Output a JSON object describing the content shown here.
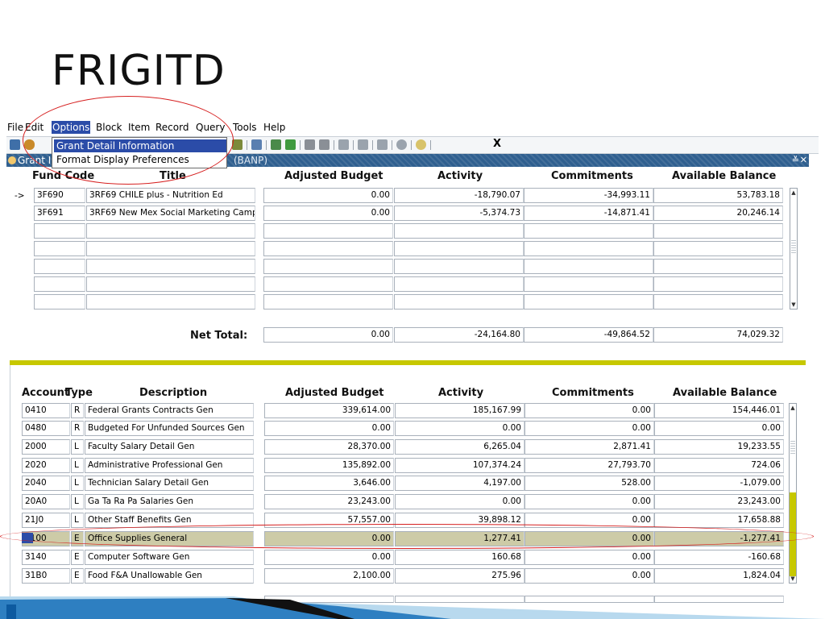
{
  "slide": {
    "title": "FRIGITD"
  },
  "menu": {
    "items": [
      {
        "label": "File"
      },
      {
        "label": "Edit"
      },
      {
        "label": "Options"
      },
      {
        "label": "Block"
      },
      {
        "label": "Item"
      },
      {
        "label": "Record"
      },
      {
        "label": "Query"
      },
      {
        "label": "Tools"
      },
      {
        "label": "Help"
      }
    ]
  },
  "toolbar": {
    "exit_label": "X"
  },
  "dropdown": {
    "item1": "Grant Detail Information [FRIGTRD]",
    "item2": "Format Display Preferences"
  },
  "window": {
    "title": "Grant I",
    "suffix": "(BANP)"
  },
  "fund_section": {
    "headers": {
      "fund_code": "Fund Code",
      "title": "Title",
      "adjusted_budget": "Adjusted Budget",
      "activity": "Activity",
      "commitments": "Commitments",
      "available_balance": "Available Balance"
    },
    "current_marker": "->",
    "rows": [
      {
        "fund_code": "3F690",
        "title": "3RF69 CHILE plus - Nutrition Ed",
        "adjusted_budget": "0.00",
        "activity": "-18,790.07",
        "commitments": "-34,993.11",
        "available_balance": "53,783.18"
      },
      {
        "fund_code": "3F691",
        "title": "3RF69 New Mex Social Marketing Camp",
        "adjusted_budget": "0.00",
        "activity": "-5,374.73",
        "commitments": "-14,871.41",
        "available_balance": "20,246.14"
      }
    ],
    "net_total_label": "Net Total:",
    "net_total": {
      "adjusted_budget": "0.00",
      "activity": "-24,164.80",
      "commitments": "-49,864.52",
      "available_balance": "74,029.32"
    }
  },
  "account_section": {
    "headers": {
      "account": "Account",
      "type": "Type",
      "description": "Description",
      "adjusted_budget": "Adjusted Budget",
      "activity": "Activity",
      "commitments": "Commitments",
      "available_balance": "Available Balance"
    },
    "rows": [
      {
        "account": "0410",
        "type": "R",
        "description": "Federal Grants Contracts Gen",
        "adjusted_budget": "339,614.00",
        "activity": "185,167.99",
        "commitments": "0.00",
        "available_balance": "154,446.01"
      },
      {
        "account": "0480",
        "type": "R",
        "description": "Budgeted For Unfunded Sources Gen",
        "adjusted_budget": "0.00",
        "activity": "0.00",
        "commitments": "0.00",
        "available_balance": "0.00"
      },
      {
        "account": "2000",
        "type": "L",
        "description": "Faculty Salary Detail Gen",
        "adjusted_budget": "28,370.00",
        "activity": "6,265.04",
        "commitments": "2,871.41",
        "available_balance": "19,233.55"
      },
      {
        "account": "2020",
        "type": "L",
        "description": "Administrative Professional Gen",
        "adjusted_budget": "135,892.00",
        "activity": "107,374.24",
        "commitments": "27,793.70",
        "available_balance": "724.06"
      },
      {
        "account": "2040",
        "type": "L",
        "description": "Technician Salary Detail Gen",
        "adjusted_budget": "3,646.00",
        "activity": "4,197.00",
        "commitments": "528.00",
        "available_balance": "-1,079.00"
      },
      {
        "account": "20A0",
        "type": "L",
        "description": "Ga Ta Ra Pa Salaries Gen",
        "adjusted_budget": "23,243.00",
        "activity": "0.00",
        "commitments": "0.00",
        "available_balance": "23,243.00"
      },
      {
        "account": "21J0",
        "type": "L",
        "description": "Other Staff Benefits Gen",
        "adjusted_budget": "57,557.00",
        "activity": "39,898.12",
        "commitments": "0.00",
        "available_balance": "17,658.88"
      },
      {
        "account": "3100",
        "type": "E",
        "description": "Office Supplies General",
        "adjusted_budget": "0.00",
        "activity": "1,277.41",
        "commitments": "0.00",
        "available_balance": "-1,277.41"
      },
      {
        "account": "3140",
        "type": "E",
        "description": "Computer Software Gen",
        "adjusted_budget": "0.00",
        "activity": "160.68",
        "commitments": "0.00",
        "available_balance": "-160.68"
      },
      {
        "account": "31B0",
        "type": "E",
        "description": "Food F&A Unallowable Gen",
        "adjusted_budget": "2,100.00",
        "activity": "275.96",
        "commitments": "0.00",
        "available_balance": "1,824.04"
      }
    ]
  },
  "colors": {
    "highlight_row": "#cdcba7",
    "accent_bar": "#c7c800",
    "annotation": "#d62020",
    "menu_active": "#2b4ca8"
  }
}
